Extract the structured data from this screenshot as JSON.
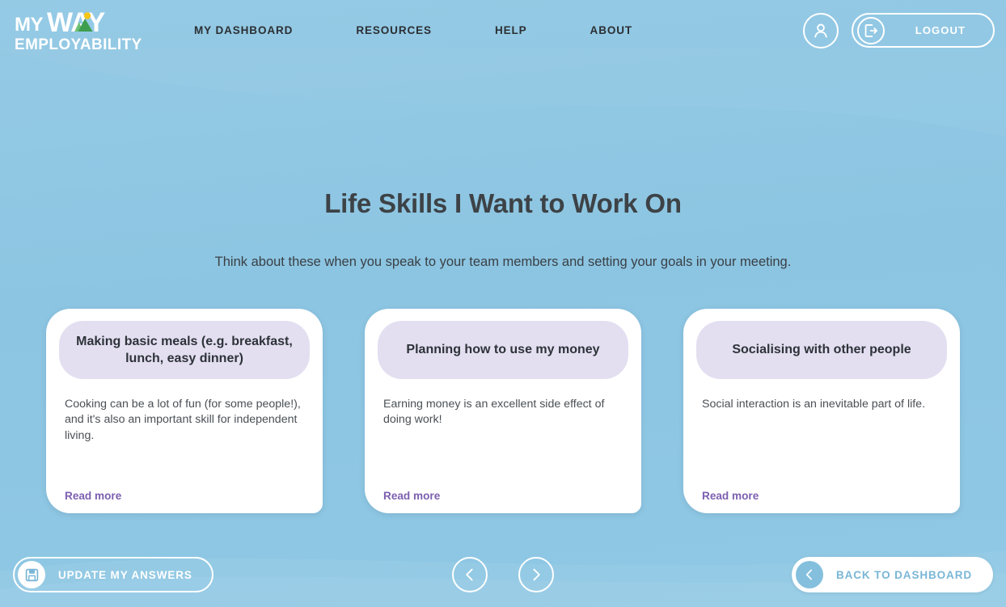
{
  "brand": {
    "line1_prefix": "MY",
    "line1_word": "WAY",
    "line2": "EMPLOYABILITY"
  },
  "nav": {
    "items": [
      {
        "label": "MY DASHBOARD"
      },
      {
        "label": "RESOURCES"
      },
      {
        "label": "HELP"
      },
      {
        "label": "ABOUT"
      }
    ]
  },
  "header": {
    "avatar_icon": "user-icon",
    "logout_icon": "logout-icon",
    "logout_label": "LOGOUT"
  },
  "main": {
    "title": "Life Skills I Want to Work On",
    "subtitle": "Think about these when you speak to your team members and setting your goals in your meeting.",
    "cards": [
      {
        "title": "Making basic meals (e.g. breakfast, lunch, easy dinner)",
        "body": "Cooking can be a lot of fun (for some people!), and it's also an important skill for independent living.",
        "read_more": "Read more"
      },
      {
        "title": "Planning how to use my money",
        "body": "Earning money is an excellent side effect of doing work!",
        "read_more": "Read more"
      },
      {
        "title": "Socialising with other people",
        "body": "Social interaction is an inevitable part of life.",
        "read_more": "Read more"
      }
    ]
  },
  "footer": {
    "update_label": "UPDATE MY ANSWERS",
    "update_icon": "save-floppy-icon",
    "prev_icon": "chevron-left-icon",
    "next_icon": "chevron-right-icon",
    "dashboard_label": "BACK TO DASHBOARD",
    "dashboard_icon": "chevron-left-icon"
  },
  "colors": {
    "background": "#8fc7e3",
    "card_header": "#e3dff1",
    "read_more": "#7c5fb0",
    "title_text": "#3d4246",
    "dashboard_text": "#7ab6d6",
    "logo_mountain": "#4caa5b",
    "logo_sun": "#f5c518"
  }
}
